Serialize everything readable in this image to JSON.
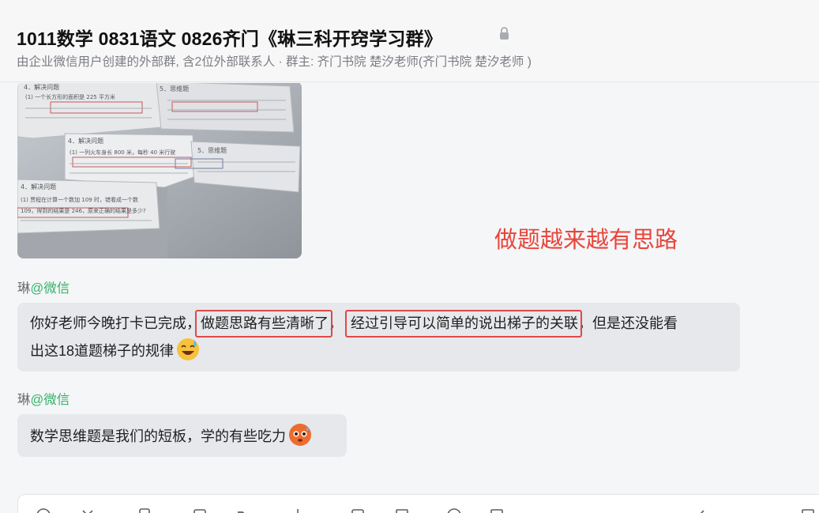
{
  "header": {
    "title": "1011数学 0831语文 0826齐门《琳三科开窍学习群》",
    "subtitle": "由企业微信用户创建的外部群, 含2位外部联系人 · 群主: 齐门书院 楚汐老师(齐门书院 楚汐老师 )",
    "lock_icon": "lock-icon"
  },
  "annotation": {
    "text": "做题越来越有思路",
    "color": "#e8453c"
  },
  "messages": [
    {
      "sender_name": "琳",
      "sender_tag": "@微信",
      "line1_a": "你好老师今晚打卡已完成，",
      "line1_hl1": "做题思路有些清晰了",
      "line1_b": "，",
      "line1_hl2": "经过引导可以简单的说出梯子的关联",
      "line1_c": "，但是还没能看",
      "line2": "出这18道题梯子的规律",
      "emoji": "sweat-laugh-emoji"
    },
    {
      "sender_name": "琳",
      "sender_tag": "@微信",
      "text": "数学思维题是我们的短板，学的有些吃力",
      "emoji": "pleading-face-emoji"
    }
  ],
  "photo": {
    "texts": {
      "sec4a": "4．解决问题",
      "sec5a": "5．思维题",
      "sec4b": "4．解决问题",
      "sec5b": "5．思维题",
      "sec4c": "4．解决问题",
      "line_a": "(1) 一个长方形的面积是 225 平方米",
      "line_b": "(1) 一列火车身长 800 米，每秒 40 米行驶",
      "line_c": "(1) 贾程在计算一个数加 109 时，错看成一个数",
      "line_d": "109，得到的结果是 246，原来正确的结果是多少?"
    }
  },
  "colors": {
    "accent_green": "#34b36b",
    "highlight_red": "#e04848",
    "bubble_bg": "#e6e8ec"
  }
}
